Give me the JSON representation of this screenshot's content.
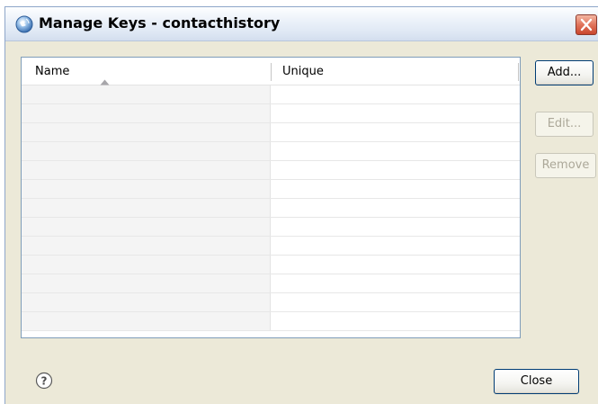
{
  "window": {
    "title": "Manage Keys - contacthistory",
    "app_icon": "eclipse-globe-icon",
    "close_icon": "close-x-icon"
  },
  "table": {
    "columns": [
      {
        "label": "Name",
        "sort": "ascending"
      },
      {
        "label": "Unique"
      }
    ],
    "rows": [
      {
        "name": "",
        "unique": ""
      },
      {
        "name": "",
        "unique": ""
      },
      {
        "name": "",
        "unique": ""
      },
      {
        "name": "",
        "unique": ""
      },
      {
        "name": "",
        "unique": ""
      },
      {
        "name": "",
        "unique": ""
      },
      {
        "name": "",
        "unique": ""
      },
      {
        "name": "",
        "unique": ""
      },
      {
        "name": "",
        "unique": ""
      },
      {
        "name": "",
        "unique": ""
      },
      {
        "name": "",
        "unique": ""
      },
      {
        "name": "",
        "unique": ""
      },
      {
        "name": "",
        "unique": ""
      }
    ]
  },
  "buttons": {
    "add": {
      "label": "Add...",
      "enabled": true
    },
    "edit": {
      "label": "Edit...",
      "enabled": false
    },
    "remove": {
      "label": "Remove",
      "enabled": false
    },
    "close": {
      "label": "Close",
      "enabled": true
    }
  },
  "footer": {
    "help_icon": "help-question-icon"
  },
  "colors": {
    "dialog_background": "#ece9d8",
    "table_border": "#7f9db9",
    "close_button_red": "#c9462d",
    "disabled_text": "#aca899"
  }
}
